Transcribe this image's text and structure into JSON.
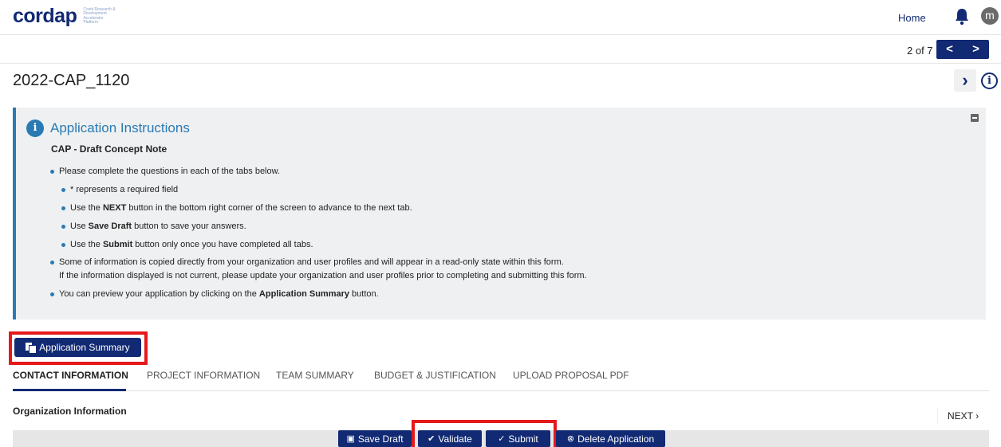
{
  "brand": {
    "name": "cordap",
    "tagline": "Covid Research & Development Accelerator Platform"
  },
  "topnav": {
    "home": "Home",
    "avatar_letter": "m"
  },
  "pager": {
    "text": "2 of 7",
    "prev": "<",
    "next": ">"
  },
  "application": {
    "id": "2022-CAP_1120"
  },
  "instructions": {
    "title": "Application Instructions",
    "subtitle": "CAP - Draft Concept Note",
    "items": [
      "Please complete the questions in each of the tabs below.",
      "* represents a required field",
      "Use the NEXT button in the bottom right corner of the screen to advance to the next tab.",
      "Use Save Draft button to save your answers.",
      "Use the Submit button only once you have completed all tabs.",
      "Some of information is copied directly from your organization and user profiles and will appear in a read-only state within this form.",
      "If the information displayed is not current, please update your organization and user profiles prior to completing and submitting this form.",
      "You can preview your application by clicking on the Application Summary button."
    ],
    "bold_terms": {
      "next": "NEXT",
      "save_draft": "Save Draft",
      "submit": "Submit",
      "summary": "Application Summary"
    }
  },
  "summary_button": "Application Summary",
  "tabs": [
    "CONTACT INFORMATION",
    "PROJECT INFORMATION",
    "TEAM SUMMARY",
    "BUDGET & JUSTIFICATION",
    "UPLOAD PROPOSAL PDF"
  ],
  "section_label": "Organization Information",
  "next_label": "NEXT",
  "actions": {
    "save_draft": "Save Draft",
    "validate": "Validate",
    "submit": "Submit",
    "delete": "Delete Application"
  },
  "colors": {
    "primary": "#122a73",
    "info": "#2a7ab3",
    "highlight": "#e5181b",
    "panel": "#eef0f1"
  }
}
